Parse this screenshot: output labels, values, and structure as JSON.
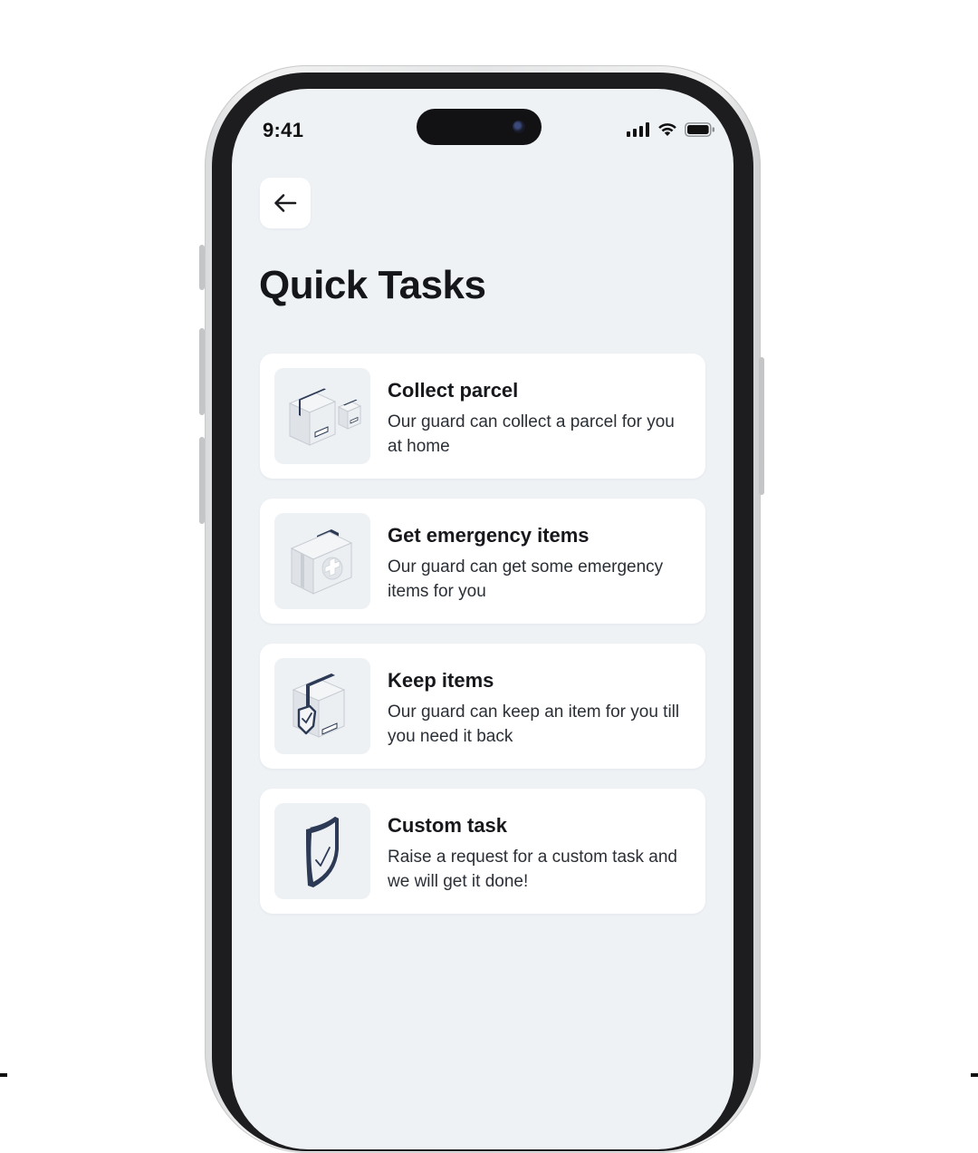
{
  "status_bar": {
    "time": "9:41",
    "icons": [
      "cellular-signal-icon",
      "wifi-icon",
      "battery-icon"
    ]
  },
  "header": {
    "back_icon": "arrow-left-icon",
    "title": "Quick Tasks"
  },
  "tasks": [
    {
      "title": "Collect parcel",
      "description": "Our guard can collect a parcel for you at home",
      "icon": "parcel-boxes-icon"
    },
    {
      "title": "Get emergency items",
      "description": "Our guard can get some emergency items for you",
      "icon": "first-aid-kit-icon"
    },
    {
      "title": "Keep items",
      "description": "Our guard can keep an item for you till you need it back",
      "icon": "secure-box-icon"
    },
    {
      "title": "Custom task",
      "description": "Raise a request for a custom task and we will get it done!",
      "icon": "shield-check-icon"
    }
  ],
  "colors": {
    "screen_background": "#eef2f5",
    "card_background": "#ffffff",
    "accent_navy": "#2c3a55"
  }
}
